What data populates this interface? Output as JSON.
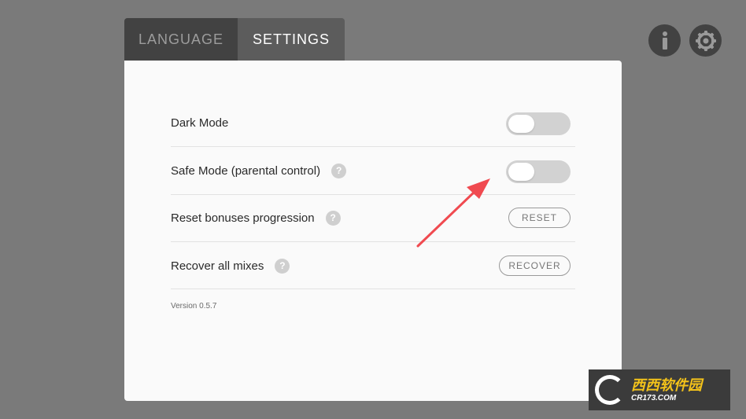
{
  "tabs": [
    {
      "label": "LANGUAGE",
      "active": false
    },
    {
      "label": "SETTINGS",
      "active": true
    }
  ],
  "header_icons": {
    "info": "info-icon",
    "settings": "gear-icon"
  },
  "settings": {
    "dark_mode": {
      "label": "Dark Mode",
      "enabled": false
    },
    "safe_mode": {
      "label": "Safe Mode (parental control)",
      "help": "?",
      "enabled": false
    },
    "reset_bonuses": {
      "label": "Reset bonuses progression",
      "help": "?",
      "button": "RESET"
    },
    "recover_mixes": {
      "label": "Recover all mixes",
      "help": "?",
      "button": "RECOVER"
    }
  },
  "version": "Version 0.5.7",
  "annotation": {
    "color": "#f04a50"
  },
  "watermark": {
    "main": "西西软件园",
    "sub": "CR173.COM"
  },
  "colors": {
    "background": "#7a7a7a",
    "panel": "#fafafa",
    "tab_active": "#5c5c5c",
    "tab_inactive": "#424242",
    "toggle_off": "#d2d2d2"
  }
}
